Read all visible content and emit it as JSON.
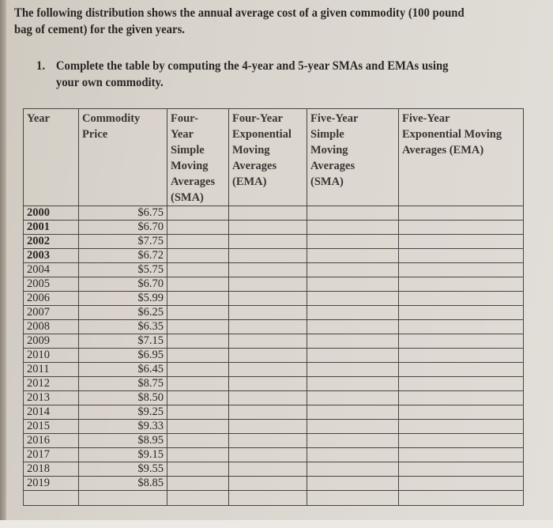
{
  "intro": {
    "line1": "The following distribution shows the annual average cost of a given commodity (100 pound",
    "line2": "bag of cement) for the given years."
  },
  "task": {
    "number": "1.",
    "line1": "Complete the table by computing the 4-year and 5-year SMAs and EMAs using",
    "line2": "your own commodity."
  },
  "table": {
    "headers": {
      "year": "Year",
      "price": [
        "Commodity",
        "Price"
      ],
      "sma4": [
        "Four-",
        "Year",
        "Simple",
        "Moving",
        "Averages",
        "(SMA)"
      ],
      "ema4": [
        "Four-Year",
        "Exponential",
        "Moving",
        "Averages",
        "(EMA)"
      ],
      "sma5": [
        "Five-Year",
        "Simple",
        "Moving",
        "Averages",
        "(SMA)"
      ],
      "ema5": [
        "Five-Year",
        "Exponential Moving",
        "Averages (EMA)"
      ]
    },
    "rows": [
      {
        "year": "2000",
        "price": "$6.75",
        "bold": true
      },
      {
        "year": "2001",
        "price": "$6.70",
        "bold": true
      },
      {
        "year": "2002",
        "price": "$7.75",
        "bold": true
      },
      {
        "year": "2003",
        "price": "$6.72",
        "bold": true
      },
      {
        "year": "2004",
        "price": "$5.75",
        "bold": false
      },
      {
        "year": "2005",
        "price": "$6.70",
        "bold": false
      },
      {
        "year": "2006",
        "price": "$5.99",
        "bold": false
      },
      {
        "year": "2007",
        "price": "$6.25",
        "bold": false
      },
      {
        "year": "2008",
        "price": "$6.35",
        "bold": false
      },
      {
        "year": "2009",
        "price": "$7.15",
        "bold": false
      },
      {
        "year": "2010",
        "price": "$6.95",
        "bold": false
      },
      {
        "year": "2011",
        "price": "$6.45",
        "bold": false
      },
      {
        "year": "2012",
        "price": "$8.75",
        "bold": false
      },
      {
        "year": "2013",
        "price": "$8.50",
        "bold": false
      },
      {
        "year": "2014",
        "price": "$9.25",
        "bold": false
      },
      {
        "year": "2015",
        "price": "$9.33",
        "bold": false
      },
      {
        "year": "2016",
        "price": "$8.95",
        "bold": false
      },
      {
        "year": "2017",
        "price": "$9.15",
        "bold": false
      },
      {
        "year": "2018",
        "price": "$9.55",
        "bold": false
      },
      {
        "year": "2019",
        "price": "$8.85",
        "bold": false
      }
    ],
    "trailing_empty_rows": 1
  }
}
